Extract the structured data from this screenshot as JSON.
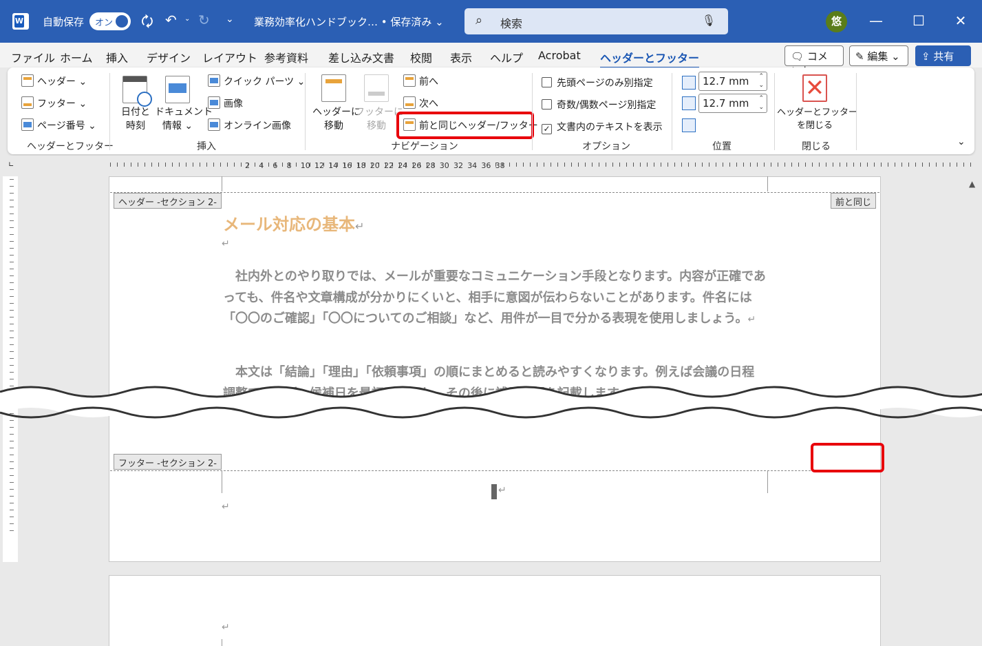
{
  "titlebar": {
    "autosave_label": "自動保存",
    "autosave_state": "オン",
    "doc_title": "業務効率化ハンドブック… • 保存済み ⌄",
    "search_placeholder": "検索",
    "avatar_text": "悠"
  },
  "menu": {
    "tabs": [
      "ファイル",
      "ホーム",
      "挿入",
      "デザイン",
      "レイアウト",
      "参考資料",
      "差し込み文書",
      "校閲",
      "表示",
      "ヘルプ",
      "Acrobat",
      "ヘッダーとフッター"
    ],
    "active_tab": "ヘッダーとフッター",
    "comment_label": "コメント",
    "edit_label": "編集",
    "share_label": "共有"
  },
  "ribbon": {
    "hf_group": {
      "header": "ヘッダー",
      "footer": "フッター",
      "page_number": "ページ番号",
      "label": "ヘッダーとフッター"
    },
    "insert_group": {
      "date_time_l1": "日付と",
      "date_time_l2": "時刻",
      "doc_info_l1": "ドキュメント",
      "doc_info_l2": "情報",
      "quick_parts": "クイック パーツ",
      "image": "画像",
      "online_image": "オンライン画像",
      "label": "挿入"
    },
    "nav_group": {
      "goto_header_l1": "ヘッダーに",
      "goto_header_l2": "移動",
      "goto_footer_l1": "フッターに",
      "goto_footer_l2": "移動",
      "prev": "前へ",
      "next": "次へ",
      "link_prev": "前と同じヘッダー/フッター",
      "label": "ナビゲーション"
    },
    "options_group": {
      "first_page": "先頭ページのみ別指定",
      "odd_even": "奇数/偶数ページ別指定",
      "show_text": "文書内のテキストを表示",
      "first_page_checked": false,
      "odd_even_checked": false,
      "show_text_checked": true,
      "label": "オプション"
    },
    "position_group": {
      "header_top": "12.7 mm",
      "footer_bottom": "12.7 mm",
      "label": "位置"
    },
    "close_group": {
      "close_l1": "ヘッダーとフッター",
      "close_l2": "を閉じる",
      "label": "閉じる"
    }
  },
  "ruler": {
    "numbers": [
      "2",
      "4",
      "6",
      "8",
      "10",
      "12",
      "14",
      "16",
      "18",
      "20",
      "22",
      "24",
      "26",
      "28",
      "30",
      "32",
      "34",
      "36",
      "38"
    ]
  },
  "document": {
    "header_tag": "ヘッダー -セクション 2-",
    "same_as_prev": "前と同じ",
    "heading": "メール対応の基本",
    "para1": "社内外とのやり取りでは、メールが重要なコミュニケーション手段となります。内容が正確であっても、件名や文章構成が分かりにくいと、相手に意図が伝わらないことがあります。件名には「〇〇のご確認」「〇〇についてのご相談」など、用件が一目で分かる表現を使用しましょう。",
    "para2": "本文は「結論」「理由」「依頼事項」の順にまとめると読みやすくなります。例えば会議の日程調整であれば、候補日を最初に提示し、その後に補足情報を記載します。ま",
    "footer_tag": "フッター -セクション 2-",
    "return_mark": "↵"
  },
  "colors": {
    "titlebar": "#2b5fb4",
    "accent": "#1a56b3",
    "highlight": "#e8000b",
    "heading": "#e8b77a"
  }
}
